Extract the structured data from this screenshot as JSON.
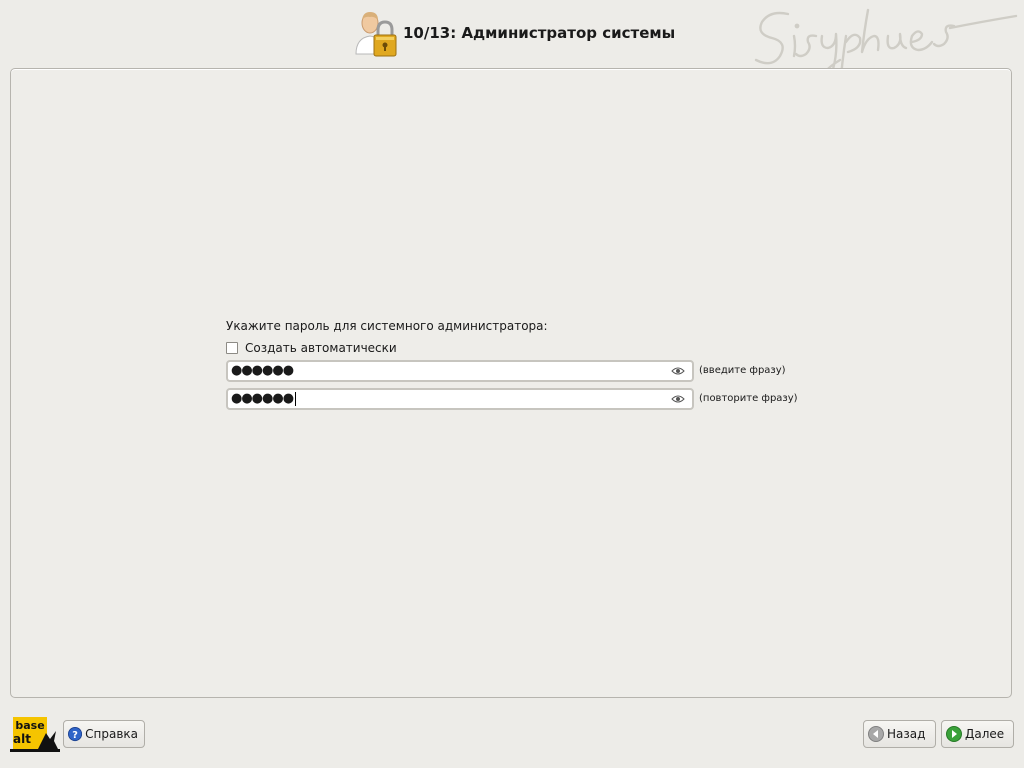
{
  "header": {
    "title": "10/13: Администратор системы",
    "brand_signature": "Sisyphus",
    "icon": "user-lock-icon"
  },
  "form": {
    "prompt": "Укажите пароль для системного администратора:",
    "auto_checkbox": {
      "label": "Создать автоматически",
      "checked": false
    },
    "password": {
      "value": "●●●●●●",
      "hint": "(введите фразу)",
      "icon": "eye-icon"
    },
    "confirm": {
      "value": "●●●●●●",
      "hint": "(повторите фразу)",
      "icon": "eye-icon"
    }
  },
  "footer": {
    "logo_text": [
      "base",
      "alt"
    ],
    "help_label": "Справка",
    "back_label": "Назад",
    "next_label": "Далее"
  },
  "colors": {
    "background": "#edece8",
    "logo_yellow": "#f5c400",
    "help_icon_blue": "#2f64c8",
    "next_icon_green": "#3aa13a",
    "back_icon_gray": "#a8a8a8"
  }
}
